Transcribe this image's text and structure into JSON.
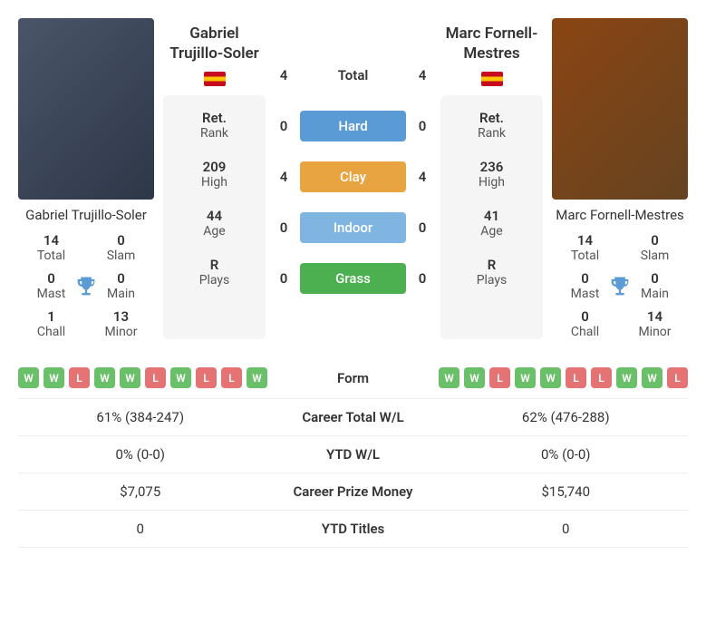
{
  "player1": {
    "name": "Gabriel Trujillo-Soler",
    "country": "spain",
    "stats": {
      "total": {
        "value": "14",
        "label": "Total"
      },
      "slam": {
        "value": "0",
        "label": "Slam"
      },
      "mast": {
        "value": "0",
        "label": "Mast"
      },
      "main": {
        "value": "0",
        "label": "Main"
      },
      "chall": {
        "value": "1",
        "label": "Chall"
      },
      "minor": {
        "value": "13",
        "label": "Minor"
      }
    },
    "info": {
      "rank": {
        "value": "Ret.",
        "label": "Rank"
      },
      "high": {
        "value": "209",
        "label": "High"
      },
      "age": {
        "value": "44",
        "label": "Age"
      },
      "plays": {
        "value": "R",
        "label": "Plays"
      }
    },
    "form": [
      "W",
      "W",
      "L",
      "W",
      "W",
      "L",
      "W",
      "L",
      "L",
      "W"
    ],
    "career_wl": "61% (384-247)",
    "ytd_wl": "0% (0-0)",
    "prize_money": "$7,075",
    "ytd_titles": "0"
  },
  "player2": {
    "name": "Marc Fornell-Mestres",
    "country": "spain",
    "stats": {
      "total": {
        "value": "14",
        "label": "Total"
      },
      "slam": {
        "value": "0",
        "label": "Slam"
      },
      "mast": {
        "value": "0",
        "label": "Mast"
      },
      "main": {
        "value": "0",
        "label": "Main"
      },
      "chall": {
        "value": "0",
        "label": "Chall"
      },
      "minor": {
        "value": "14",
        "label": "Minor"
      }
    },
    "info": {
      "rank": {
        "value": "Ret.",
        "label": "Rank"
      },
      "high": {
        "value": "236",
        "label": "High"
      },
      "age": {
        "value": "41",
        "label": "Age"
      },
      "plays": {
        "value": "R",
        "label": "Plays"
      }
    },
    "form": [
      "W",
      "W",
      "L",
      "W",
      "W",
      "L",
      "L",
      "W",
      "W",
      "L"
    ],
    "career_wl": "62% (476-288)",
    "ytd_wl": "0% (0-0)",
    "prize_money": "$15,740",
    "ytd_titles": "0"
  },
  "h2h": {
    "total": {
      "p1": "4",
      "label": "Total",
      "p2": "4"
    },
    "hard": {
      "p1": "0",
      "label": "Hard",
      "p2": "0"
    },
    "clay": {
      "p1": "4",
      "label": "Clay",
      "p2": "4"
    },
    "indoor": {
      "p1": "0",
      "label": "Indoor",
      "p2": "0"
    },
    "grass": {
      "p1": "0",
      "label": "Grass",
      "p2": "0"
    }
  },
  "comparison_labels": {
    "form": "Form",
    "career_wl": "Career Total W/L",
    "ytd_wl": "YTD W/L",
    "prize_money": "Career Prize Money",
    "ytd_titles": "YTD Titles"
  }
}
